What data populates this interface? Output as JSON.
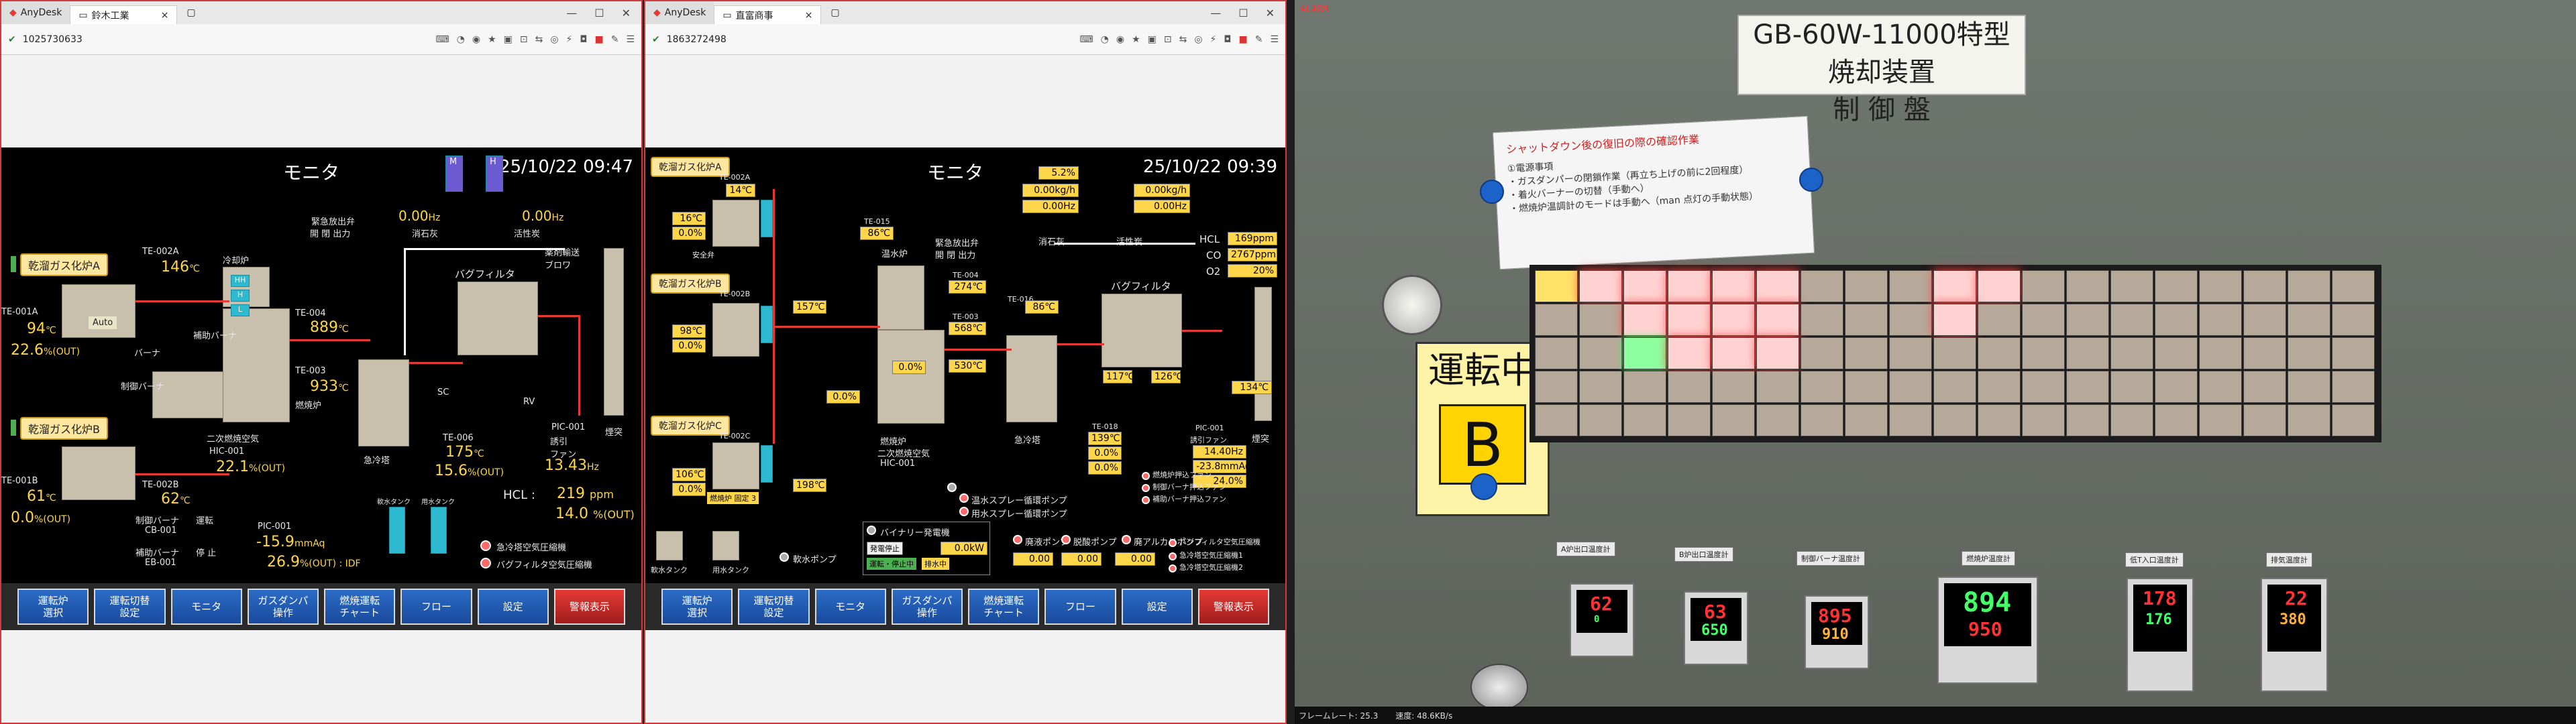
{
  "windows": [
    {
      "app": "AnyDesk",
      "tab": "鈴木工業",
      "id": "1025730633",
      "hmi": {
        "title": "モニタ",
        "datetime": "25/10/22 09:47",
        "labels": {
          "gas_a": "乾溜ガス化炉A",
          "gas_b": "乾溜ガス化炉B",
          "te001a": "TE-001A",
          "te001b": "TE-001B",
          "te002a": "TE-002A",
          "te002b": "TE-002B",
          "te003": "TE-003",
          "te004": "TE-004",
          "te006": "TE-006",
          "cooling": "冷却炉",
          "emergency": "緊急放出弁",
          "emergency_sub": "開 閉 出力",
          "aux_burner": "補助バーナ",
          "burner": "バーナ",
          "control_burner": "制御バーナ",
          "aux_burner2": "補助バーナ",
          "combustion": "燃焼炉",
          "secondary_air": "二次燃焼空気",
          "hic001": "HIC-001",
          "quench": "急冷塔",
          "bagfilter": "バグフィルタ",
          "stack": "煙突",
          "slaked_lime": "消石灰",
          "activated_carbon": "活性炭",
          "ash_transport": "薬剤輸送\nブロワ",
          "induced_fan": "誘引\nファン",
          "pic001": "PIC-001",
          "hcl": "HCL :",
          "run": "運転",
          "stop": "停 止",
          "cb001": "CB-001",
          "eb001": "EB-001",
          "soft_tank": "軟水タンク",
          "raw_tank": "用水タンク",
          "quench_alarm": "急冷塔空気圧縮機",
          "bag_alarm": "バグフィルタ空気圧縮機",
          "auto": "Auto",
          "hh": "HH",
          "h": "H",
          "l": "L",
          "m": "M",
          "sc": "SC",
          "rv": "RV"
        },
        "values": {
          "temp_a1": "146",
          "temp_a2": "94",
          "pct_a": "22.6",
          "temp_b1": "61",
          "temp_b2": "62",
          "pct_b": "0.0",
          "te004": "889",
          "te003": "933",
          "hic": "22.1",
          "te006": "175",
          "fan_pct": "15.6",
          "hz_1": "0.00",
          "hz_2": "0.00",
          "hz_fan": "13.43",
          "hcl": "219",
          "hcl_unit": "ppm",
          "o2": "14.0",
          "o2_unit": "%(OUT)",
          "pic": "-15.9",
          "pic_unit": "mmAq",
          "pic_pct": "26.9",
          "pic_tail": "%(OUT) : IDF",
          "unit_c": "℃",
          "unit_hz": "Hz",
          "unit_out": "%(OUT)"
        }
      },
      "buttons": [
        "運転炉\n選択",
        "運転切替\n設定",
        "モニタ",
        "ガスダンパ\n操作",
        "燃焼運転\nチャート",
        "フロー",
        "設定",
        "警報表示"
      ]
    },
    {
      "app": "AnyDesk",
      "tab": "直富商事",
      "id": "1863272498",
      "hmi": {
        "title": "モニタ",
        "datetime": "25/10/22 09:39",
        "labels": {
          "gas_a": "乾溜ガス化炉A",
          "gas_b": "乾溜ガス化炉B",
          "gas_c": "乾溜ガス化炉C",
          "te002a": "TE-002A",
          "te002b": "TE-002B",
          "te002c": "TE-002C",
          "te004": "TE-004",
          "te003": "TE-003",
          "te015": "TE-015",
          "te016": "TE-016",
          "te018": "TE-018",
          "warm": "温水炉",
          "combustion": "燃焼炉",
          "secondary_air": "二次燃焼空気",
          "hic001": "HIC-001",
          "quench": "急冷塔",
          "bagfilter": "バグフィルタ",
          "stack": "煙突",
          "induced_fan": "誘引ファン",
          "slaked_lime": "消石灰",
          "activated_carbon": "活性炭",
          "emergency": "緊急放出弁",
          "emergency_sub": "開 閉 出力",
          "safety": "安全弁",
          "hot_water": "温水",
          "hcl": "HCL",
          "co": "CO",
          "o2": "O2",
          "pic001": "PIC-001",
          "dismantle": "解体ボンプ",
          "drain": "廃液ポンプ",
          "soft_tank": "軟水タンク",
          "raw_tank": "用水タンク",
          "soft_pump": "軟水ポンプ",
          "binary": "バイナリー発電機",
          "binary_stop": "発電停止",
          "kw": "kW",
          "rec_pump": "温水スプレー循環ポンプ",
          "raw_pump": "用水スプレー循環ポンプ",
          "waste_pump": "廃液ポンプ",
          "drain_pump": "脱酸ポンプ",
          "alkali": "廃アルカリポンプ",
          "fan1": "燃焼炉押込ファン",
          "fan2": "制御バーナ押込ファン",
          "fan3": "補助バーナ押込ファン",
          "alarm1": "急冷塔空気圧縮機1",
          "alarm2": "急冷塔空気圧縮機2",
          "alarm3": "バグフィルタ空気圧縮機",
          "state": "運転・停止中",
          "drain_lbl": "排水中",
          "state2": "運転",
          "fixed": "燃焼炉 固定 3"
        },
        "values": {
          "a_temp": "14",
          "a_t1": "16",
          "a_pct": "0.0",
          "b_temp": "157",
          "b_t1": "98",
          "b_pct": "0.0",
          "c_temp": "198",
          "c_t1": "106",
          "c_pct": "0.0",
          "warm_temp": "86",
          "te004": "274",
          "te018": "86",
          "te003": "568",
          "te003b": "530",
          "o2_top": "5.2",
          "kgh1": "0.00",
          "kgh2": "0.00",
          "hz1": "0.00",
          "hz2": "0.00",
          "hcl": "169",
          "co": "2767",
          "o2": "20",
          "stack_temp": "134",
          "fan_hz": "14.40",
          "pic": "-23.8",
          "pic_pct": "24.0",
          "quench_t": "139",
          "quench_pct": "0.0",
          "quench_pct2": "0.0",
          "fan_out1": "0.00",
          "fan_out2": "0.00",
          "fan_out3": "0.00",
          "kw": "0.0",
          "burner_pct": "0.0",
          "burner2_pct": "0.0",
          "t117": "117",
          "t126": "126",
          "hcl_unit": "ppm",
          "o2_unit": "%",
          "hz_unit": "Hz",
          "mmaq": "mmAq",
          "kgh": "kg/h",
          "unit_c": "℃",
          "unit_pct": "%"
        }
      },
      "buttons": [
        "運転炉\n選択",
        "運転切替\n設定",
        "モニタ",
        "ガスダンパ\n操作",
        "燃焼運転\nチャート",
        "フロー",
        "設定",
        "警報表示"
      ]
    }
  ],
  "camera": {
    "title_line1": "GB-60W-11000特型 焼却装置",
    "title_line2": "制 御 盤",
    "note_title": "シャットダウン後の復旧の際の確認作業",
    "note_lines": [
      "①電源事項",
      "・ガスダンパーの閉鎖作業（再立ち上げの前に2回程度）",
      "・着火バーナーの切替（手動へ）",
      "・燃焼炉温調計のモードは手動へ（man 点灯の手動状態）"
    ],
    "unten": "運転中",
    "unten_letter": "B",
    "meters": [
      {
        "label": "A炉出口温度計",
        "top": "62",
        "bottom": "0"
      },
      {
        "label": "B炉出口温度計",
        "top": "63",
        "bottom": "650"
      },
      {
        "label": "制御バーナ温度計",
        "top": "895",
        "bottom": "910"
      },
      {
        "label": "燃焼炉温度計",
        "top": "894",
        "bottom": "950"
      },
      {
        "label": "低T入口温度計",
        "top": "178",
        "bottom": "176"
      },
      {
        "label": "排気温度計",
        "top": "22",
        "bottom": "380"
      }
    ],
    "status": {
      "fps": "フレームレート: 25.3",
      "speed": "速度: 48.6KB/s"
    },
    "cam_tag": "ALARM"
  },
  "colors": {
    "accent": "#ffd54a",
    "alarm": "#e53935",
    "button": "#2b6cc7",
    "ok_green": "#3aff5a"
  }
}
